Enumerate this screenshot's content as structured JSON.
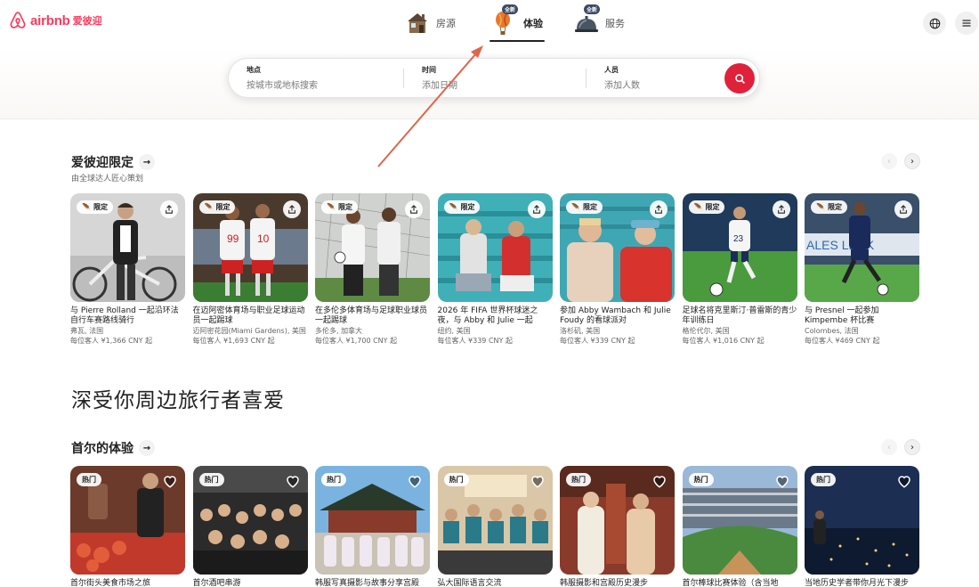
{
  "brand": {
    "name": "airbnb",
    "cn": "爱彼迎",
    "color": "#ff385c"
  },
  "nav": [
    {
      "label": "房源",
      "icon": "house-icon",
      "badge": ""
    },
    {
      "label": "体验",
      "icon": "hot-air-balloon-icon",
      "badge": "全新",
      "active": true
    },
    {
      "label": "服务",
      "icon": "service-bell-icon",
      "badge": "全新"
    }
  ],
  "header_right": {
    "globe": "globe-icon",
    "menu": "hamburger-menu-icon"
  },
  "search": {
    "where_title": "地点",
    "where_placeholder": "按城市或地标搜索",
    "when_title": "时间",
    "when_placeholder": "添加日期",
    "who_title": "人员",
    "who_placeholder": "添加人数",
    "button_icon": "search-icon",
    "button_color": "#e0213a"
  },
  "section1": {
    "title": "爱彼迎限定",
    "subtitle": "由全球达人匠心策划",
    "cards": [
      {
        "badge": "限定",
        "title": "与 Pierre Rolland 一起沿环法自行车赛路线骑行",
        "location": "弗瓦, 法国",
        "price": "每位客人 ¥1,366 CNY 起"
      },
      {
        "badge": "限定",
        "title": "在迈阿密体育场与职业足球运动员一起踢球",
        "location": "迈阿密花园(Miami Gardens), 美国",
        "price": "每位客人 ¥1,693 CNY 起"
      },
      {
        "badge": "限定",
        "title": "在多伦多体育场与足球职业球员一起踢球",
        "location": "多伦多, 加拿大",
        "price": "每位客人 ¥1,700 CNY 起"
      },
      {
        "badge": "限定",
        "title": "2026 年 FIFA 世界杯球迷之夜，与 Abby 和 Julie 一起",
        "location": "纽约, 美国",
        "price": "每位客人 ¥339 CNY 起"
      },
      {
        "badge": "限定",
        "title": "参加 Abby Wambach 和 Julie Foudy 的看球派对",
        "location": "洛杉矶, 美国",
        "price": "每位客人 ¥339 CNY 起"
      },
      {
        "badge": "限定",
        "title": "足球名将克里斯汀·普雷斯的青少年训练日",
        "location": "格伦代尔, 美国",
        "price": "每位客人 ¥1,016 CNY 起"
      },
      {
        "badge": "限定",
        "title": "与 Presnel 一起参加 Kimpembe 杯比赛",
        "location": "Colombes, 法国",
        "price": "每位客人 ¥469 CNY 起"
      }
    ]
  },
  "big_title": "深受你周边旅行者喜爱",
  "section2": {
    "title": "首尔的体验",
    "cards": [
      {
        "badge": "热门",
        "title": "首尔街头美食市场之旅"
      },
      {
        "badge": "热门",
        "title": "首尔酒吧串游"
      },
      {
        "badge": "热门",
        "title": "韩服写真摄影与故事分享宫殿"
      },
      {
        "badge": "热门",
        "title": "弘大国际语言交流"
      },
      {
        "badge": "热门",
        "title": "韩服摄影和宫殿历史漫步"
      },
      {
        "badge": "热门",
        "title": "首尔棒球比赛体验（含当地"
      },
      {
        "badge": "热门",
        "title": "当地历史学者带你月光下漫步"
      }
    ]
  }
}
